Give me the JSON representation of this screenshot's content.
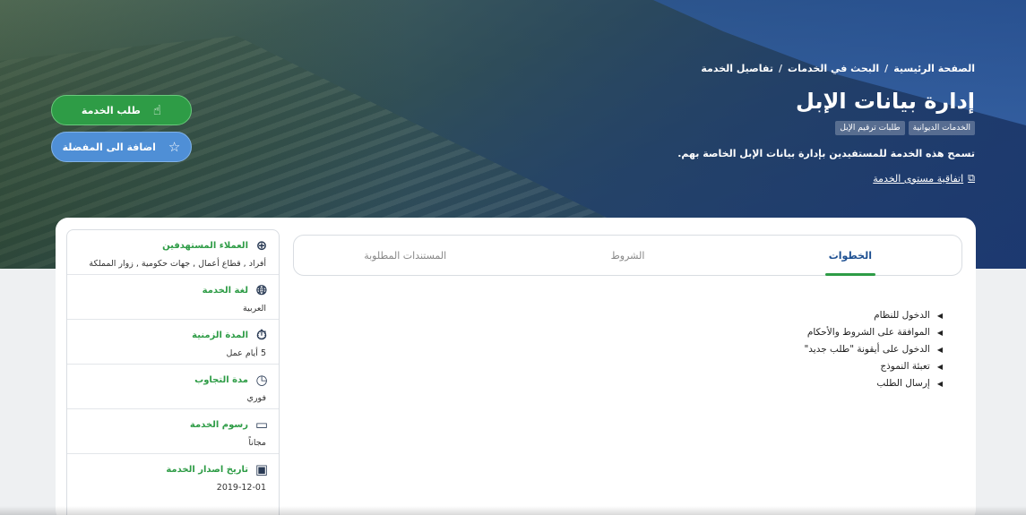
{
  "breadcrumb": [
    "الصفحة الرئيسية",
    "البحث في الخدمات",
    "تفاصيل الخدمة"
  ],
  "service": {
    "title": "إدارة بيانات الإبل",
    "tags": [
      "الخدمات الديوانية",
      "طلبات ترقيم الإبل"
    ],
    "description": "تسمح هذه الخدمة للمستفيدين بإدارة بيانات الإبل الخاصة بهم.",
    "sla_link": "اتفاقية مستوى الخدمة"
  },
  "actions": {
    "request_label": "طلب الخدمة",
    "favorite_label": "اضافة الى المفضلة"
  },
  "tabs": [
    {
      "label": "الخطوات",
      "active": true
    },
    {
      "label": "الشروط",
      "active": false
    },
    {
      "label": "المستندات المطلوبة",
      "active": false
    }
  ],
  "steps": [
    "الدخول للنظام",
    "الموافقة على الشروط والأحكام",
    "الدخول على أيقونة \"طلب جديد\"",
    "تعبئة النموذج",
    "إرسال الطلب"
  ],
  "sidebar": [
    {
      "label": "العملاء المستهدفين",
      "value": "أفراد , قطاع أعمال , جهات حكومية , زوار المملكة",
      "icon": "target-users-icon"
    },
    {
      "label": "لغة الخدمة",
      "value": "العربية",
      "icon": "globe-icon"
    },
    {
      "label": "المدة الزمنية",
      "value": "5 أيام عمل",
      "icon": "stopwatch-icon"
    },
    {
      "label": "مدة التجاوب",
      "value": "فوري",
      "icon": "clock-icon"
    },
    {
      "label": "رسوم الخدمة",
      "value": "مجاناً",
      "icon": "card-icon"
    },
    {
      "label": "تاريخ اصدار الخدمة",
      "value": "2019-12-01",
      "icon": "calendar-icon"
    }
  ],
  "colors": {
    "accent": "#2e9c46",
    "primary": "#1d4f91",
    "secondary_button": "#4f8fd6"
  }
}
